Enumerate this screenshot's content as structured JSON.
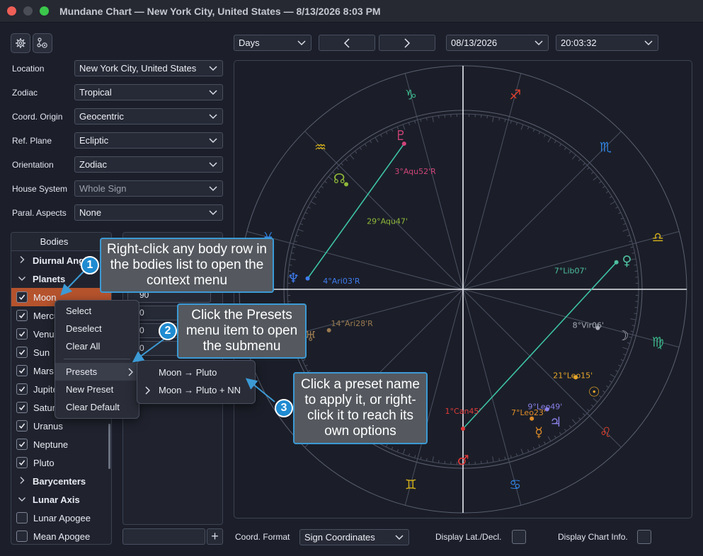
{
  "window": {
    "title": "Mundane Chart — New York City, United States — 8/13/2026 8:03 PM"
  },
  "toolbar": {
    "settings_icon": "gear-icon",
    "chart_settings_icon": "gear-network-icon",
    "period": "Days",
    "date": "08/13/2026",
    "time": "20:03:32"
  },
  "settings": [
    {
      "label": "Location",
      "value": "New York City, United States"
    },
    {
      "label": "Zodiac",
      "value": "Tropical"
    },
    {
      "label": "Coord. Origin",
      "value": "Geocentric"
    },
    {
      "label": "Ref. Plane",
      "value": "Ecliptic"
    },
    {
      "label": "Orientation",
      "value": "Zodiac"
    },
    {
      "label": "House System",
      "value": "Whole Sign"
    },
    {
      "label": "Paral. Aspects",
      "value": "None"
    }
  ],
  "bodies": {
    "header": "Bodies",
    "rows": [
      {
        "type": "group",
        "label": "Diurnal Angles",
        "expanded": false
      },
      {
        "type": "group",
        "label": "Planets",
        "expanded": true
      },
      {
        "type": "item",
        "label": "Moon",
        "checked": true,
        "selected": true
      },
      {
        "type": "item",
        "label": "Mercury",
        "checked": true
      },
      {
        "type": "item",
        "label": "Venus",
        "checked": true
      },
      {
        "type": "item",
        "label": "Sun",
        "checked": true
      },
      {
        "type": "item",
        "label": "Mars",
        "checked": true
      },
      {
        "type": "item",
        "label": "Jupiter",
        "checked": true
      },
      {
        "type": "item",
        "label": "Saturn",
        "checked": true
      },
      {
        "type": "item",
        "label": "Uranus",
        "checked": true
      },
      {
        "type": "item",
        "label": "Neptune",
        "checked": true
      },
      {
        "type": "item",
        "label": "Pluto",
        "checked": true
      },
      {
        "type": "group",
        "label": "Barycenters",
        "expanded": false
      },
      {
        "type": "group",
        "label": "Lunar Axis",
        "expanded": true
      },
      {
        "type": "item",
        "label": "Lunar Apogee",
        "checked": false
      },
      {
        "type": "item",
        "label": "Mean Apogee",
        "checked": false
      }
    ],
    "second_column": [
      "90",
      "0",
      "0",
      "0"
    ]
  },
  "context_menu": {
    "items": [
      "Select",
      "Deselect",
      "Clear All"
    ],
    "presets": "Presets",
    "more": [
      "New Preset",
      "Clear Default"
    ]
  },
  "submenu": {
    "items": [
      "Moon → Pluto",
      "Moon → Pluto + NN"
    ]
  },
  "callouts": [
    {
      "n": "1",
      "text": "Right-click any body row in the bodies list to open the context menu"
    },
    {
      "n": "2",
      "text": "Click the Presets menu item to open the submenu"
    },
    {
      "n": "3",
      "text": "Click a preset name to apply it, or right-click it to reach its own options"
    }
  ],
  "bottom": {
    "coord_format_label": "Coord. Format",
    "coord_format_value": "Sign Coordinates",
    "latdecl_label": "Display Lat./Decl.",
    "chartinfo_label": "Display Chart Info."
  },
  "chart": {
    "zodiac_glyphs": [
      {
        "g": "♑",
        "c": "#3ab58a"
      },
      {
        "g": "♐",
        "c": "#e0402f"
      },
      {
        "g": "♏",
        "c": "#2f83e2"
      },
      {
        "g": "♎",
        "c": "#d6b21b"
      },
      {
        "g": "♍",
        "c": "#3ab58a"
      },
      {
        "g": "♌",
        "c": "#e0402f"
      },
      {
        "g": "♋",
        "c": "#2f83e2"
      },
      {
        "g": "♊",
        "c": "#d6b21b"
      },
      {
        "g": "♉",
        "c": "#3ab58a"
      },
      {
        "g": "♈",
        "c": "#e0402f"
      },
      {
        "g": "♓",
        "c": "#2f83e2"
      },
      {
        "g": "♒",
        "c": "#d6b21b"
      }
    ],
    "planets": [
      {
        "glyph": "♇",
        "label": "3°Aqu52'R",
        "color": "#d0447a"
      },
      {
        "glyph": "☊",
        "label": "29°Aqu47'",
        "color": "#8fb83a"
      },
      {
        "glyph": "♆",
        "label": "4°Ari03'R",
        "color": "#3f7df0"
      },
      {
        "glyph": "♅",
        "label": "14°Ari28'R",
        "color": "#9a7a50"
      },
      {
        "glyph": "♀",
        "label": "7°Lib07'",
        "color": "#4ec0a0"
      },
      {
        "glyph": "☽",
        "label": "8°Vir06'",
        "color": "#a8acb6"
      },
      {
        "glyph": "☉",
        "label": "21°Leo15'",
        "color": "#e8a72a"
      },
      {
        "glyph": "♃",
        "label": "9°Leo49'",
        "color": "#8a80e8"
      },
      {
        "glyph": "☿",
        "label": "7°Leo23'",
        "color": "#e08c28"
      },
      {
        "glyph": "♂",
        "label": "1°Can45'",
        "color": "#e23b3b"
      }
    ]
  }
}
